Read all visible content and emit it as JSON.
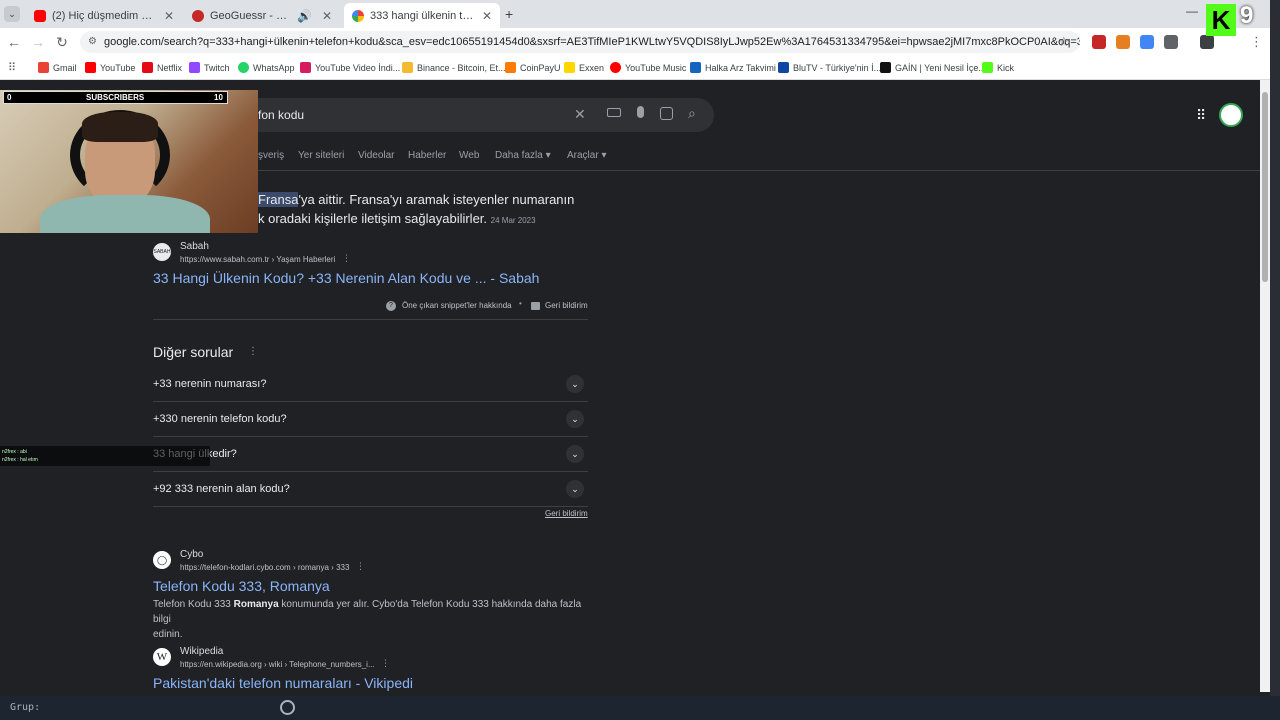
{
  "tabs": [
    {
      "title": "(2) Hiç düşmedim mi aklına - ",
      "color": "#ff0000"
    },
    {
      "title": "GeoGuessr - Let's explore th",
      "color": "#c62828"
    },
    {
      "title": "333 hangi ülkenin telefon kodu",
      "color": "#4285f4"
    }
  ],
  "toolbar": {
    "url": "google.com/search?q=333+hangi+ülkenin+telefon+kodu&sca_esv=edc10655191454d0&sxsrf=AE3TifMIeP1KWLtwY5VQDIS8IyLJwp52Ew%3A1764531334795&ei=hpwsae2jMI7mxc8PkOCP0AI&oq=333+hangi+ülke&gs_lp=Egxn..."
  },
  "bookmarks": [
    {
      "label": "Gmail",
      "color": "#ea4335"
    },
    {
      "label": "YouTube",
      "color": "#ff0000"
    },
    {
      "label": "Netflix",
      "color": "#e50914"
    },
    {
      "label": "Twitch",
      "color": "#9146ff"
    },
    {
      "label": "WhatsApp",
      "color": "#25d366"
    },
    {
      "label": "YouTube Video İndi...",
      "color": "#d81b60"
    },
    {
      "label": "Binance - Bitcoin, Et...",
      "color": "#f3ba2f"
    },
    {
      "label": "CoinPayU",
      "color": "#ff7a00"
    },
    {
      "label": "Exxen",
      "color": "#ffd600"
    },
    {
      "label": "YouTube Music",
      "color": "#ff0000"
    },
    {
      "label": "Halka Arz Takvimi",
      "color": "#1565c0"
    },
    {
      "label": "BluTV - Türkiye'nin İ...",
      "color": "#0d47a1"
    },
    {
      "label": "GAİN | Yeni Nesil İçe...",
      "color": "#111111"
    },
    {
      "label": "Kick",
      "color": "#53fc18"
    }
  ],
  "search": {
    "query_visible": "fon kodu"
  },
  "nav": [
    "şveriş",
    "Yer siteleri",
    "Videolar",
    "Haberler",
    "Web",
    "Daha fazla ▾",
    "Araçlar ▾"
  ],
  "snippet": {
    "highlight": "Fransa",
    "line1_rest": "'ya aittir. Fransa'yı aramak isteyenler numaranın",
    "line2": "k oradaki kişilerle iletişim sağlayabilirler.",
    "date": "24 Mar 2023",
    "source_name": "Sabah",
    "source_url": "https://www.sabah.com.tr › Yaşam Haberleri",
    "link": "33 Hangi Ülkenin Kodu? +33 Nerenin Alan Kodu ve ... - Sabah",
    "about": "Öne çıkan snippet'ler hakkında",
    "feedback": "Geri bildirim"
  },
  "paa": {
    "title": "Diğer sorular",
    "questions": [
      "+33 nerenin numarası?",
      "+330 nerenin telefon kodu?",
      "33 hangi ülkedir?",
      "+92 333 nerenin alan kodu?"
    ],
    "feedback": "Geri bildirim"
  },
  "results": [
    {
      "name": "Cybo",
      "url": "https://telefon-kodlari.cybo.com › romanya › 333",
      "title": "Telefon Kodu 333, Romanya",
      "snippet_a": "Telefon Kodu 333 ",
      "snippet_bold": "Romanya",
      "snippet_b": " konumunda yer alır. Cybo'da Telefon Kodu 333 hakkında daha fazla bilgi",
      "snippet_c": "edinin."
    },
    {
      "name": "Wikipedia",
      "url": "https://en.wikipedia.org › wiki › Telephone_numbers_i...",
      "title": "Pakistan'daki telefon numaraları - Vikipedi"
    }
  ],
  "overlay": {
    "subs_left": "0",
    "subs_label": "SUBSCRIBERS",
    "subs_right": "10",
    "chat1": "n2frex : abi",
    "chat2": "n2frex : hal etım",
    "group": "Grup:",
    "kick_letter": "K",
    "kick_number": "9"
  }
}
